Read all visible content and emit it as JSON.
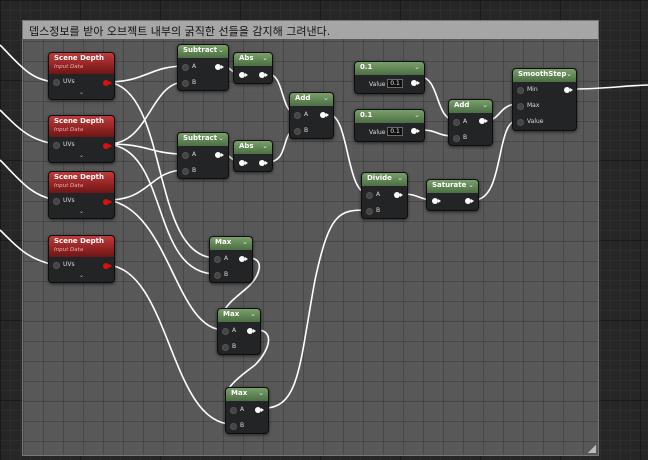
{
  "comment": {
    "text": "뎁스정보를 받아 오브젝트 내부의 굵직한 선들을 감지해 그려낸다."
  },
  "nodes": {
    "sd1": {
      "title": "Scene Depth",
      "subtitle": "Input Data",
      "pin": "UVs"
    },
    "sd2": {
      "title": "Scene Depth",
      "subtitle": "Input Data",
      "pin": "UVs"
    },
    "sd3": {
      "title": "Scene Depth",
      "subtitle": "Input Data",
      "pin": "UVs"
    },
    "sd4": {
      "title": "Scene Depth",
      "subtitle": "Input Data",
      "pin": "UVs"
    },
    "sub1": {
      "title": "Subtract",
      "a": "A",
      "b": "B"
    },
    "sub2": {
      "title": "Subtract",
      "a": "A",
      "b": "B"
    },
    "abs1": {
      "title": "Abs"
    },
    "abs2": {
      "title": "Abs"
    },
    "add1": {
      "title": "Add",
      "a": "A",
      "b": "B"
    },
    "const1": {
      "title": "0.1",
      "label": "Value",
      "value": "0.1"
    },
    "const2": {
      "title": "0.1",
      "label": "Value",
      "value": "0.1"
    },
    "add2": {
      "title": "Add",
      "a": "A",
      "b": "B"
    },
    "smooth": {
      "title": "SmoothStep",
      "min": "Min",
      "max": "Max",
      "value": "Value"
    },
    "divide": {
      "title": "Divide",
      "a": "A",
      "b": "B"
    },
    "saturate": {
      "title": "Saturate"
    },
    "max1": {
      "title": "Max",
      "a": "A",
      "b": "B"
    },
    "max2": {
      "title": "Max",
      "a": "A",
      "b": "B"
    },
    "max3": {
      "title": "Max",
      "a": "A",
      "b": "B"
    }
  },
  "colors": {
    "node_header_green": "#5e8452",
    "node_header_red": "#a22525",
    "wire": "#ffffff",
    "pin_red": "#e01010",
    "comment_bar": "#a6a6a6"
  },
  "icons": {
    "collapse": "chevron-down-icon",
    "output_pin": "pin-output-icon",
    "input_pin": "pin-input-icon"
  }
}
